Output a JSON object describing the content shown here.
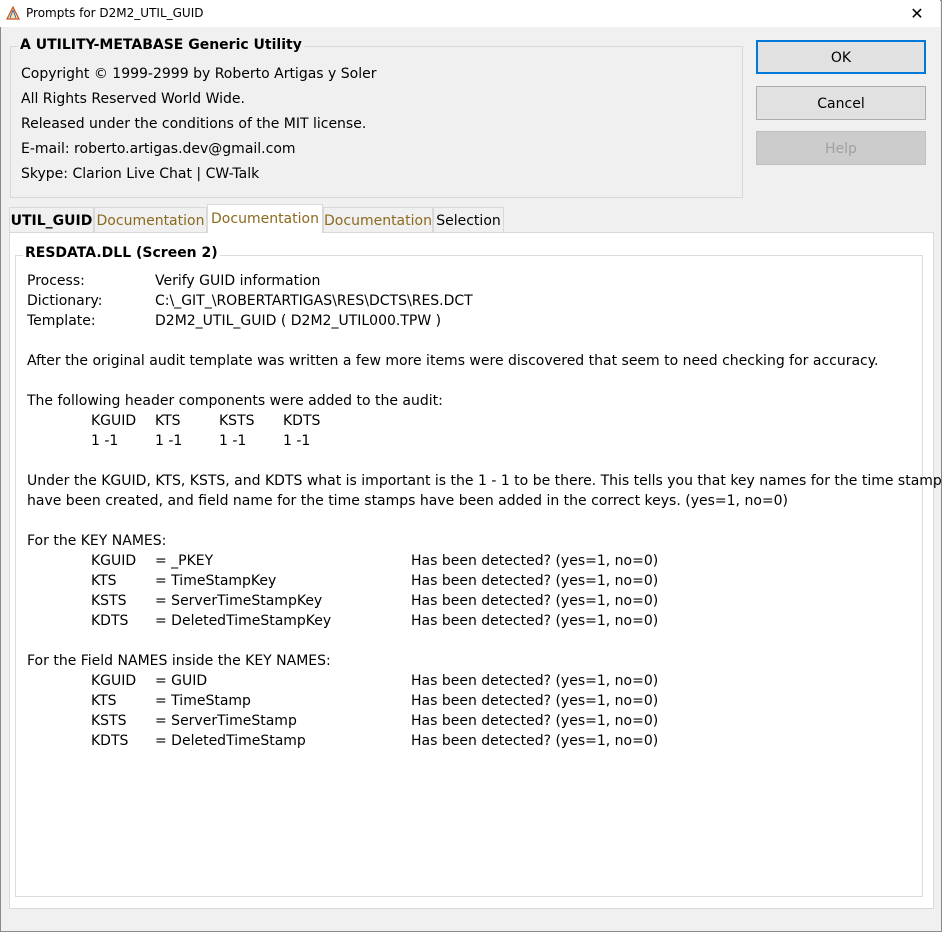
{
  "window": {
    "title": "Prompts for D2M2_UTIL_GUID",
    "close_glyph": "✕"
  },
  "header": {
    "title": "A UTILITY-METABASE Generic Utility",
    "lines": [
      "Copyright © 1999-2999 by Roberto Artigas y Soler",
      "All Rights Reserved World Wide.",
      "Released under the conditions of the MIT license.",
      "E-mail: roberto.artigas.dev@gmail.com",
      "Skype: Clarion Live Chat | CW-Talk"
    ]
  },
  "buttons": {
    "ok": "OK",
    "cancel": "Cancel",
    "help": "Help"
  },
  "tabs": [
    {
      "label": "UTIL_GUID"
    },
    {
      "label": "Documentation"
    },
    {
      "label": "Documentation"
    },
    {
      "label": "Documentation"
    },
    {
      "label": "Selection"
    }
  ],
  "panel": {
    "title": "RESDATA.DLL (Screen 2)",
    "process_label": "Process:",
    "process_value": "Verify GUID information",
    "dictionary_label": "Dictionary:",
    "dictionary_value": "C:\\_GIT_\\ROBERTARTIGAS\\RES\\DCTS\\RES.DCT",
    "template_label": "Template:",
    "template_value": "D2M2_UTIL_GUID ( D2M2_UTIL000.TPW )",
    "intro": "After the original audit template was written a few more items were discovered that seem to need checking for accuracy.",
    "header_intro": "The following header components were added to the audit:",
    "header_cols": [
      "KGUID",
      "KTS",
      "KSTS",
      "KDTS"
    ],
    "header_vals": [
      "1 -1",
      "1 -1",
      "1 -1",
      "1 -1"
    ],
    "under_line1": "Under the KGUID, KTS, KSTS, and KDTS what is important is the 1 - 1 to be there. This tells you that key names for the time stamps",
    "under_line2": "have been created, and field name for the time stamps have been added in the correct keys. (yes=1, no=0)",
    "key_names_intro": "For the KEY NAMES:",
    "key_names": [
      {
        "code": "KGUID",
        "value": "= _PKEY",
        "status": "Has been detected? (yes=1, no=0)"
      },
      {
        "code": "KTS",
        "value": "= TimeStampKey",
        "status": "Has been detected? (yes=1, no=0)"
      },
      {
        "code": "KSTS",
        "value": "= ServerTimeStampKey",
        "status": "Has been detected? (yes=1, no=0)"
      },
      {
        "code": "KDTS",
        "value": "= DeletedTimeStampKey",
        "status": "Has been detected? (yes=1, no=0)"
      }
    ],
    "field_names_intro": "For the Field NAMES inside the KEY NAMES:",
    "field_names": [
      {
        "code": "KGUID",
        "value": "= GUID",
        "status": "Has been detected? (yes=1, no=0)"
      },
      {
        "code": "KTS",
        "value": "= TimeStamp",
        "status": "Has been detected? (yes=1, no=0)"
      },
      {
        "code": "KSTS",
        "value": "= ServerTimeStamp",
        "status": "Has been detected? (yes=1, no=0)"
      },
      {
        "code": "KDTS",
        "value": "= DeletedTimeStamp",
        "status": "Has been detected? (yes=1, no=0)"
      }
    ]
  },
  "colors": {
    "accent": "#0078d7",
    "doc_tab_text": "#8b6a1e"
  }
}
